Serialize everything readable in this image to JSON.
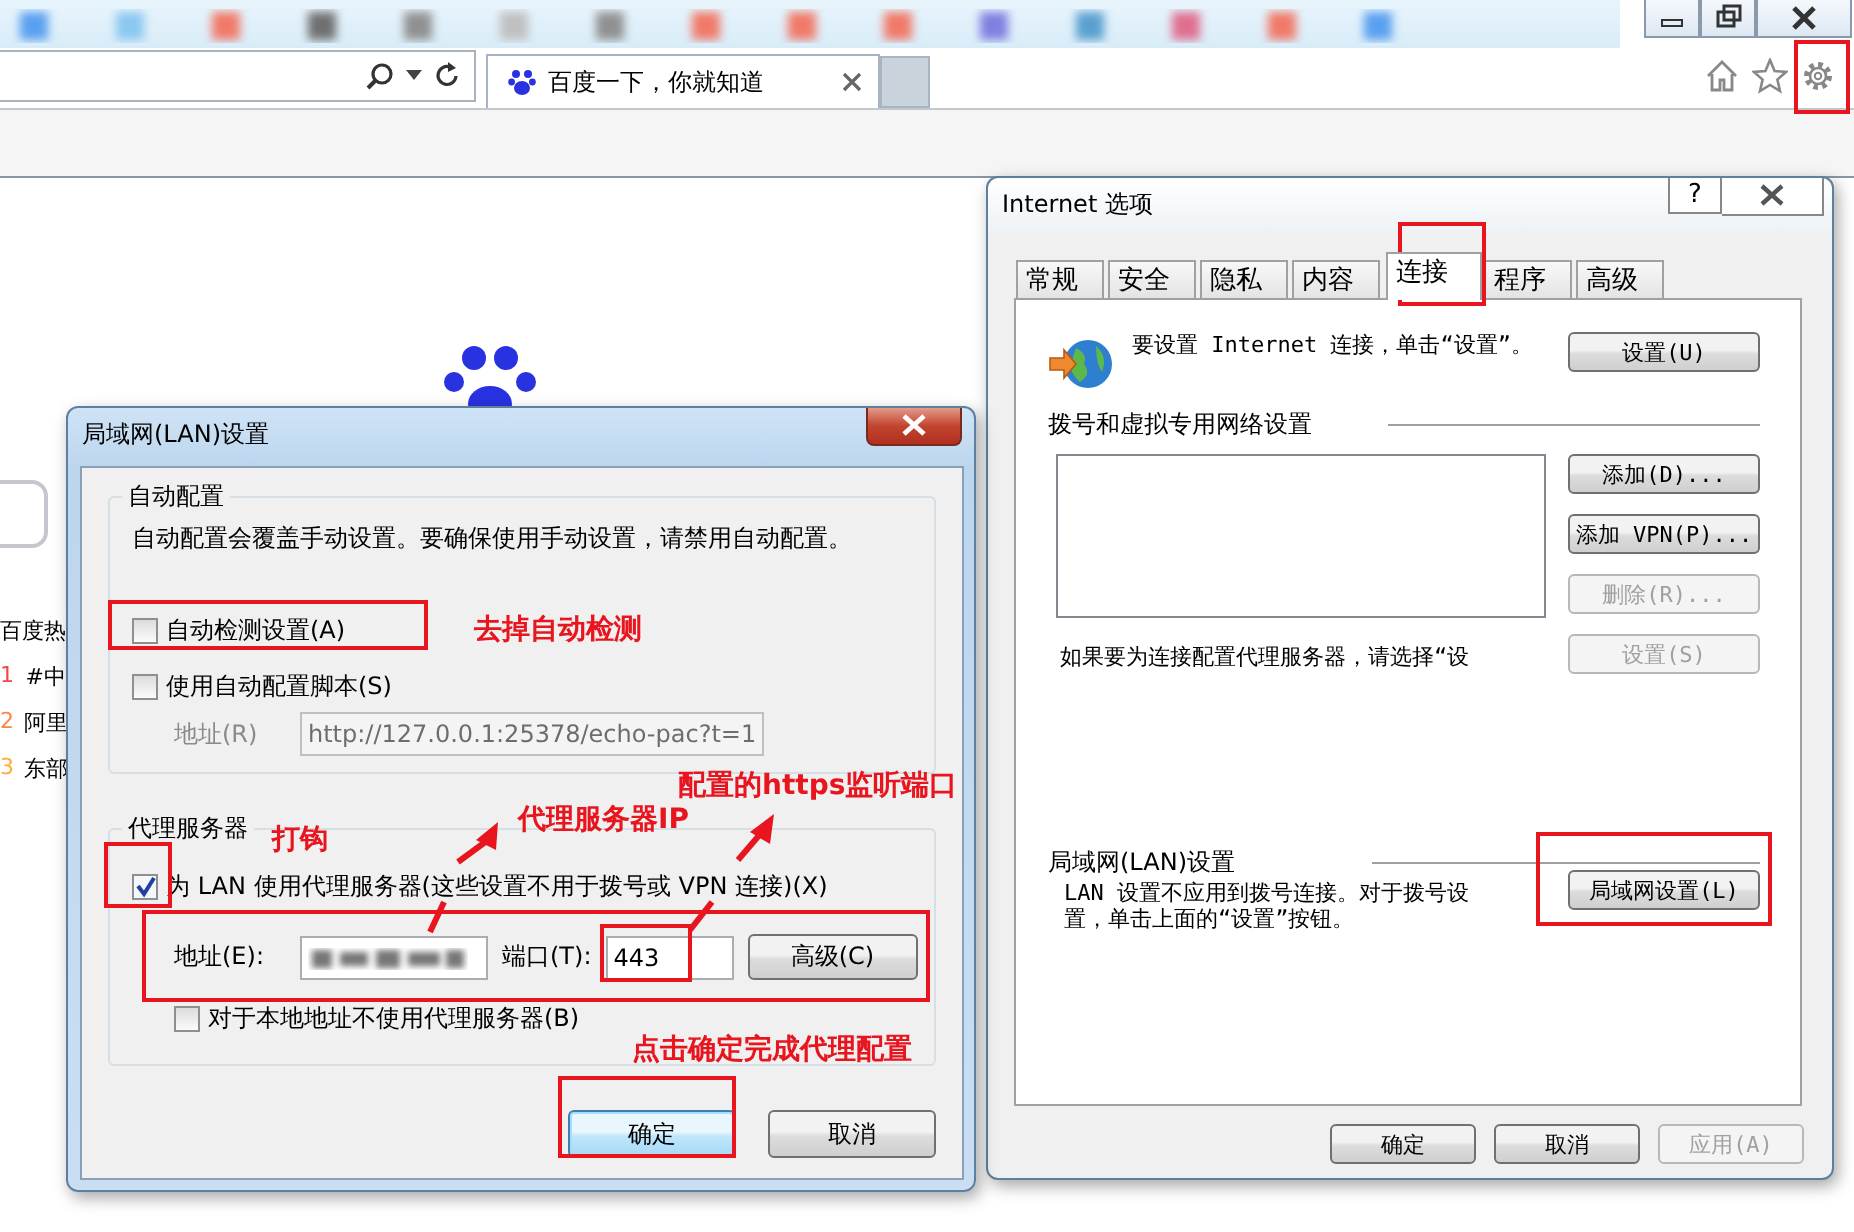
{
  "browser": {
    "tab_title": "百度一下，你就知道",
    "page": {
      "hot_heading": "百度热",
      "hot_items": [
        {
          "rank": "1",
          "text": "#中",
          "color": "#f54545"
        },
        {
          "rank": "2",
          "text": "阿里",
          "color": "#ff8547"
        },
        {
          "rank": "3",
          "text": "东部",
          "color": "#ffac38"
        }
      ]
    }
  },
  "options_dialog": {
    "title": "Internet 选项",
    "help": "?",
    "tabs": [
      {
        "label": "常规",
        "selected": false
      },
      {
        "label": "安全",
        "selected": false
      },
      {
        "label": "隐私",
        "selected": false
      },
      {
        "label": "内容",
        "selected": false
      },
      {
        "label": "连接",
        "selected": true
      },
      {
        "label": "程序",
        "selected": false
      },
      {
        "label": "高级",
        "selected": false
      }
    ],
    "connect_text": "要设置 Internet 连接，单击“设置”。",
    "setup_button": "设置(U)",
    "dialup_heading": "拨号和虚拟专用网络设置",
    "dialup_buttons": [
      {
        "label": "添加(D)...",
        "disabled": false
      },
      {
        "label": "添加 VPN(P)...",
        "disabled": false
      },
      {
        "label": "删除(R)...",
        "disabled": true
      },
      {
        "label": "设置(S)",
        "disabled": true
      }
    ],
    "proxy_hint": "如果要为连接配置代理服务器，请选择“设",
    "lan_heading": "局域网(LAN)设置",
    "lan_text": "LAN 设置不应用到拨号连接。对于拨号设置，单击上面的“设置”按钮。",
    "lan_button": "局域网设置(L)",
    "buttons": [
      {
        "label": "确定",
        "disabled": false
      },
      {
        "label": "取消",
        "disabled": false
      },
      {
        "label": "应用(A)",
        "disabled": true
      }
    ]
  },
  "lan_dialog": {
    "title": "局域网(LAN)设置",
    "auto_group": {
      "legend": "自动配置",
      "text": "自动配置会覆盖手动设置。要确保使用手动设置，请禁用自动配置。",
      "options": [
        {
          "label": "自动检测设置(A)",
          "checked": false
        },
        {
          "label": "使用自动配置脚本(S)",
          "checked": false
        }
      ],
      "address_label": "地址(R)",
      "address_value": "http://127.0.0.1:25378/echo-pac?t=1"
    },
    "proxy_group": {
      "legend": "代理服务器",
      "use_proxy": {
        "label": "为 LAN 使用代理服务器(这些设置不用于拨号或 VPN 连接)(X)",
        "checked": true
      },
      "address_label": "地址(E):",
      "port_label": "端口(T):",
      "port_value": "443",
      "advanced_button": "高级(C)",
      "bypass_local": {
        "label": "对于本地地址不使用代理服务器(B)",
        "checked": false
      }
    },
    "buttons": [
      {
        "label": "确定",
        "default": true
      },
      {
        "label": "取消",
        "default": false
      }
    ]
  },
  "annotations": [
    {
      "text": "去掉自动检测"
    },
    {
      "text": "打钩"
    },
    {
      "text": "代理服务器IP"
    },
    {
      "text": "配置的https监听端口"
    },
    {
      "text": "点击确定完成代理配置"
    }
  ]
}
